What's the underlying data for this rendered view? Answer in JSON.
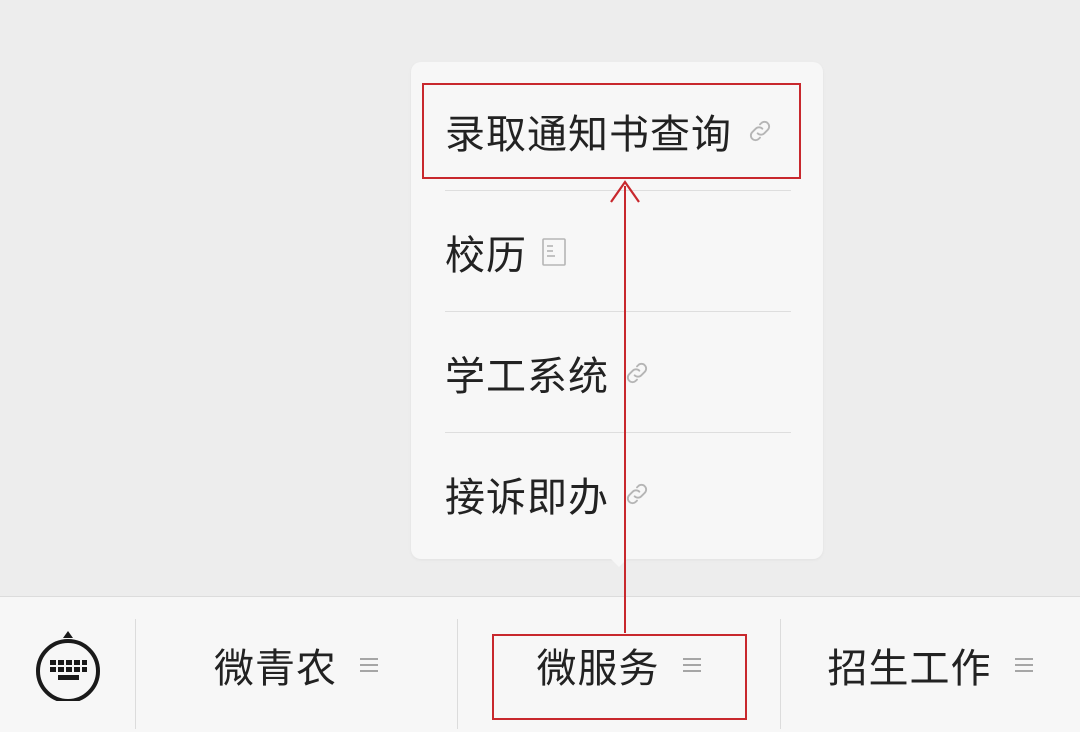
{
  "popup_menu": {
    "items": [
      {
        "label": "录取通知书查询",
        "icon": "link-icon"
      },
      {
        "label": "校历",
        "icon": "document-icon"
      },
      {
        "label": "学工系统",
        "icon": "link-icon"
      },
      {
        "label": "接诉即办",
        "icon": "link-icon"
      }
    ]
  },
  "bottom_bar": {
    "keyboard_icon": "keyboard-icon",
    "tabs": [
      {
        "label": "微青农",
        "icon": "menu-lines-icon"
      },
      {
        "label": "微服务",
        "icon": "menu-lines-icon"
      },
      {
        "label": "招生工作",
        "icon": "menu-lines-icon"
      }
    ]
  },
  "colors": {
    "annotation_red": "#c8282d",
    "background": "#ededed",
    "panel": "#f7f7f7",
    "text": "#222222",
    "icon_gray": "#b5b5b5"
  }
}
